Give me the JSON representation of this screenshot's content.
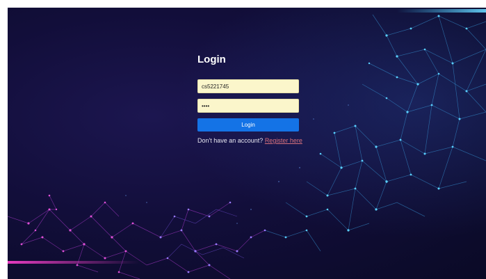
{
  "login": {
    "title": "Login",
    "username_value": "cs5221745",
    "password_value": "1234",
    "button_label": "Login",
    "register_prompt": "Don't have an account?",
    "register_link": "Register here"
  },
  "colors": {
    "background": "#120e3a",
    "input_background": "#fbf6cb",
    "button": "#1473e6",
    "register_link": "#d8717c",
    "network_blue": "#3ab0f0",
    "network_magenta": "#e040c8"
  }
}
